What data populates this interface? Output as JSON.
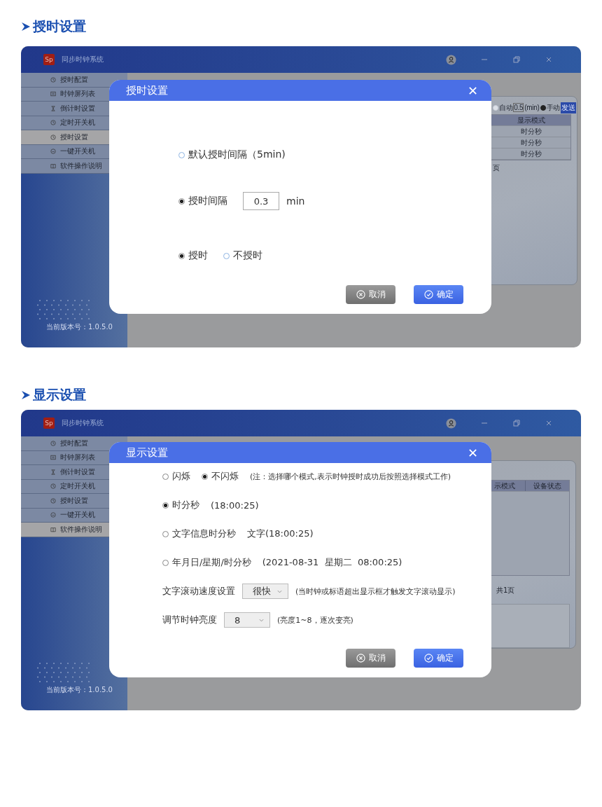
{
  "sections": [
    {
      "heading": "授时设置",
      "kind": "timing",
      "window": {
        "logo": "Sp",
        "title": "同步时钟系统",
        "sidebar": [
          {
            "label": "授时配置",
            "selected": false
          },
          {
            "label": "时钟屏列表",
            "selected": false
          },
          {
            "label": "倒计时设置",
            "selected": false
          },
          {
            "label": "定时开关机",
            "selected": false
          },
          {
            "label": "授时设置",
            "selected": true
          },
          {
            "label": "一键开关机",
            "selected": false
          },
          {
            "label": "软件操作说明",
            "selected": false
          }
        ],
        "version": "当前版本号：1.0.5.0",
        "toolbar": {
          "auto_label": "自动",
          "auto_selected": false,
          "interval": "0.5",
          "unit": "(min)",
          "manual_label": "手动",
          "manual_selected": true,
          "send": "发送"
        },
        "columns": [
          "显示模式"
        ],
        "rows": [
          [
            "时分秒"
          ],
          [
            "时分秒"
          ],
          [
            "时分秒"
          ]
        ],
        "pager": "页"
      },
      "dialog": {
        "title": "授时设置",
        "rows": [
          [
            {
              "kind": "radio",
              "label": "默认授时间隔（5min)",
              "selected": false
            }
          ],
          [
            {
              "kind": "radio",
              "label": "授时间隔",
              "selected": true
            },
            {
              "kind": "input",
              "value": "0.3"
            },
            {
              "kind": "text",
              "text": "min"
            }
          ],
          [
            {
              "kind": "radio",
              "label": "授时",
              "selected": true
            },
            {
              "kind": "radio",
              "label": "不授时",
              "selected": false
            }
          ]
        ],
        "buttons": [
          {
            "kind": "cancel",
            "label": "取消"
          },
          {
            "kind": "confirm",
            "label": "确定"
          }
        ]
      }
    },
    {
      "heading": "显示设置",
      "kind": "display",
      "window": {
        "logo": "Sp",
        "title": "同步时钟系统",
        "sidebar": [
          {
            "label": "授时配置",
            "selected": false
          },
          {
            "label": "时钟屏列表",
            "selected": false
          },
          {
            "label": "倒计时设置",
            "selected": false
          },
          {
            "label": "定时开关机",
            "selected": false
          },
          {
            "label": "授时设置",
            "selected": false
          },
          {
            "label": "一键开关机",
            "selected": false
          },
          {
            "label": "软件操作说明",
            "selected": true
          }
        ],
        "version": "当前版本号：1.0.5.0",
        "columns": [
          "示模式",
          "设备状态"
        ],
        "pager": "共1页",
        "memo_box": true
      },
      "dialog": {
        "title": "显示设置",
        "rows": [
          [
            {
              "kind": "radio",
              "label": "闪烁",
              "selected": false
            },
            {
              "kind": "radio",
              "label": "不闪烁",
              "selected": true
            },
            {
              "kind": "note",
              "text": "(注：选择哪个模式,表示时钟授时成功后按照选择模式工作)"
            }
          ],
          [
            {
              "kind": "radio",
              "label": "时分秒",
              "selected": true
            },
            {
              "kind": "text",
              "text": "(18:00:25)"
            }
          ],
          [
            {
              "kind": "radio",
              "label": "文字信息时分秒",
              "selected": false
            },
            {
              "kind": "text",
              "text": "文字(18:00:25)"
            }
          ],
          [
            {
              "kind": "radio",
              "label": "年月日/星期/时分秒",
              "selected": false
            },
            {
              "kind": "text",
              "text": "(2021-08-31  星期二  08:00:25)"
            }
          ],
          [
            {
              "kind": "text",
              "text": "文字滚动速度设置"
            },
            {
              "kind": "select",
              "value": "很快"
            },
            {
              "kind": "note",
              "text": "(当时钟或标语超出显示框才触发文字滚动显示)"
            }
          ],
          [
            {
              "kind": "text",
              "text": "调节时钟亮度"
            },
            {
              "kind": "select",
              "value": "8"
            },
            {
              "kind": "note",
              "text": "(亮度1~8，逐次变亮)"
            }
          ]
        ],
        "buttons": [
          {
            "kind": "cancel",
            "label": "取消"
          },
          {
            "kind": "confirm",
            "label": "确定"
          }
        ]
      }
    }
  ]
}
